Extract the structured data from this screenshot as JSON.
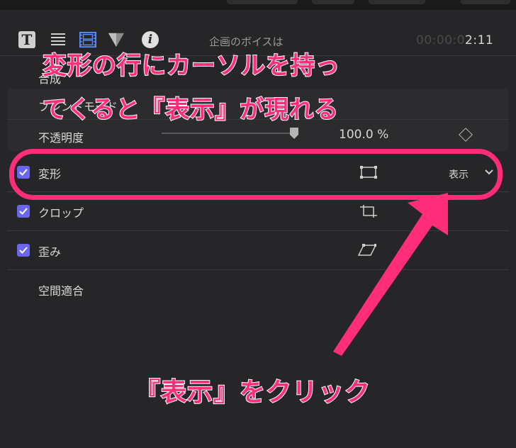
{
  "toolbar": {
    "clip_title": "企画のボイスは",
    "timecode_dim": "00:00:0",
    "timecode_lit": "2:11",
    "icons": [
      "text-inspector-icon",
      "title-inspector-icon",
      "video-inspector-icon",
      "filter-inspector-icon",
      "info-inspector-icon"
    ]
  },
  "rows": {
    "compositing": "合成",
    "blend_mode": "ブレンドモード",
    "opacity": {
      "label": "不透明度",
      "value": "100.0 %",
      "level": 1.0
    },
    "transform": {
      "label": "変形",
      "checked": true,
      "show_label": "表示"
    },
    "crop": {
      "label": "クロップ",
      "checked": true
    },
    "distort": {
      "label": "歪み",
      "checked": true
    },
    "spatial_conform": "空間適合"
  },
  "annotation": {
    "top_line1": "変形の行にカーソルを持っ",
    "top_line2": "てくると『表示』が現れる",
    "bottom": "『表示』をクリック",
    "color": "#ff2d7a"
  },
  "colors": {
    "background": "#262628",
    "checkbox": "#6a66f0",
    "accent": "#ff2d7a"
  }
}
